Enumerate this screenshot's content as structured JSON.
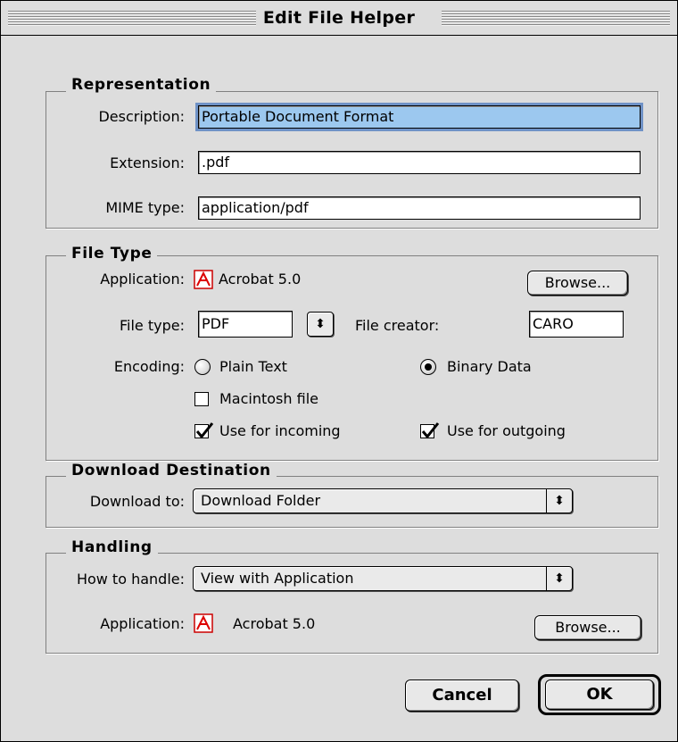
{
  "window": {
    "title": "Edit File Helper"
  },
  "representation": {
    "title": "Representation",
    "description_label": "Description:",
    "description_value": "Portable Document Format",
    "extension_label": "Extension:",
    "extension_value": ".pdf",
    "mime_label": "MIME type:",
    "mime_value": "application/pdf"
  },
  "file_type": {
    "title": "File Type",
    "application_label": "Application:",
    "application_name": "Acrobat 5.0",
    "application_icon": "acrobat-icon",
    "browse_label": "Browse...",
    "file_type_label": "File type:",
    "file_type_value": "PDF",
    "stepper_glyph": "⬍",
    "creator_label": "File creator:",
    "creator_value": "CARO",
    "encoding_label": "Encoding:",
    "plain_text_label": "Plain Text",
    "plain_text_selected": false,
    "binary_label": "Binary Data",
    "binary_selected": true,
    "mac_file_label": "Macintosh file",
    "mac_file_checked": false,
    "incoming_label": "Use for incoming",
    "incoming_checked": true,
    "outgoing_label": "Use for outgoing",
    "outgoing_checked": true
  },
  "download": {
    "title": "Download Destination",
    "label": "Download to:",
    "value": "Download Folder"
  },
  "handling": {
    "title": "Handling",
    "how_label": "How to handle:",
    "how_value": "View with Application",
    "application_label": "Application:",
    "application_name": "Acrobat 5.0",
    "browse_label": "Browse..."
  },
  "buttons": {
    "cancel": "Cancel",
    "ok": "OK"
  },
  "popup_glyph": "⬍"
}
